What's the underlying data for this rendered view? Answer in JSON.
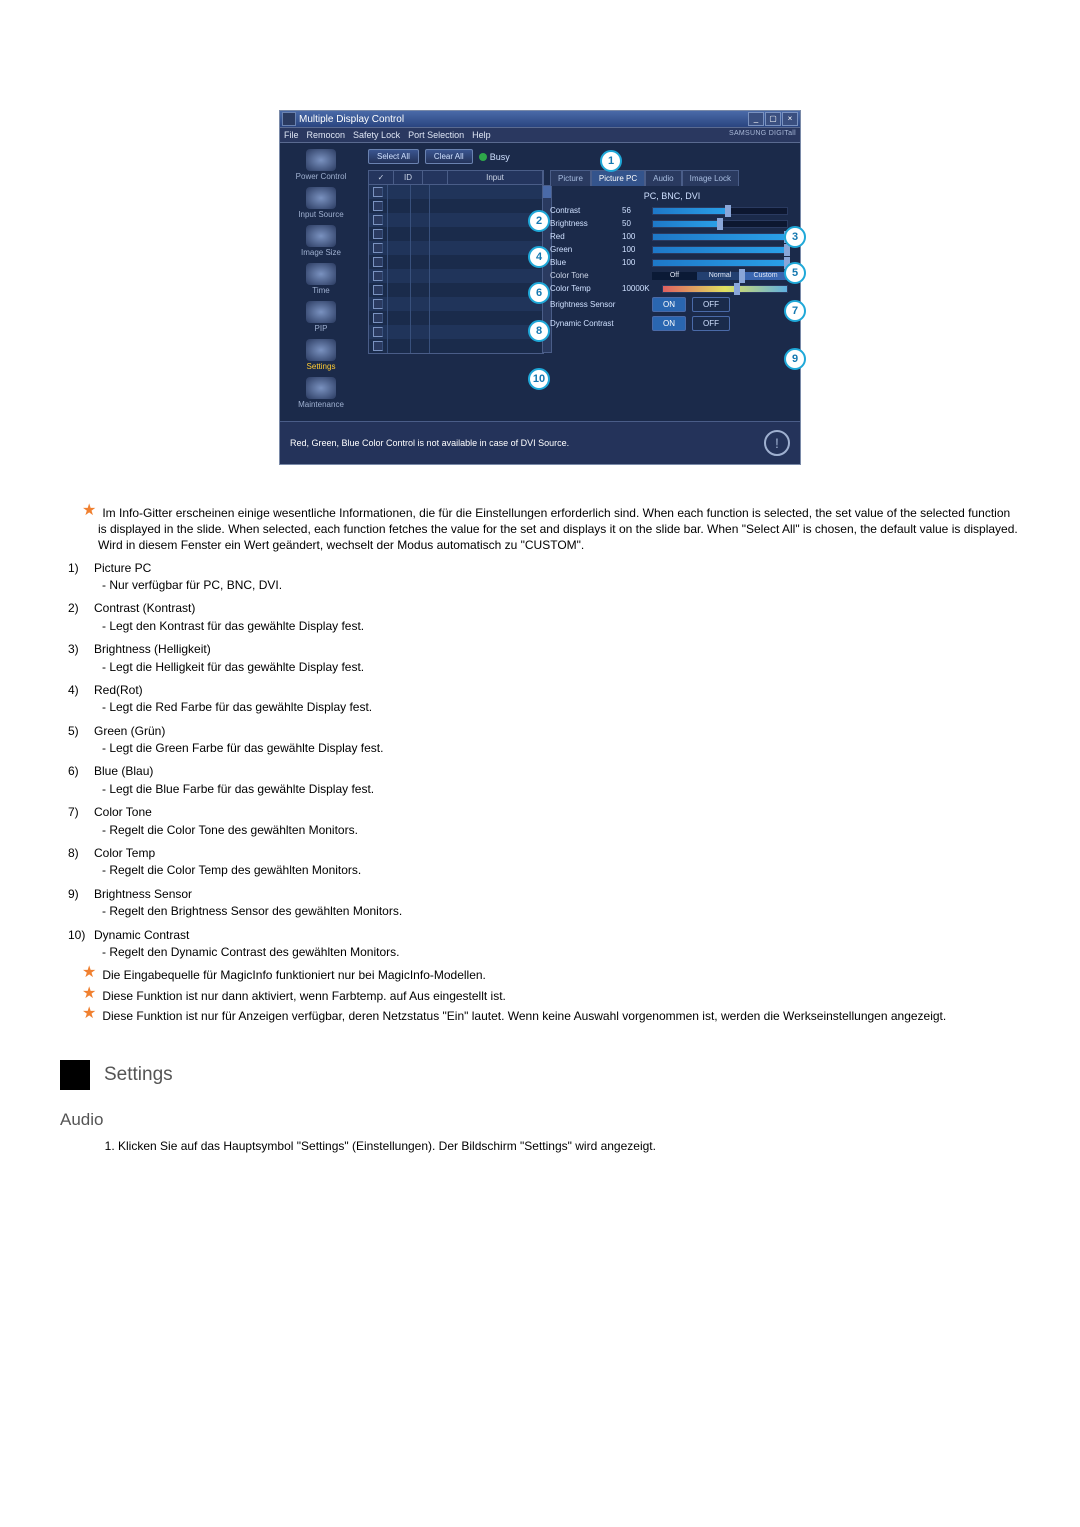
{
  "app": {
    "title": "Multiple Display Control",
    "menu": [
      "File",
      "Remocon",
      "Safety Lock",
      "Port Selection",
      "Help"
    ],
    "brand": "SAMSUNG DIGITall",
    "sidebar": [
      {
        "label": "Power Control"
      },
      {
        "label": "Input Source"
      },
      {
        "label": "Image Size"
      },
      {
        "label": "Time"
      },
      {
        "label": "PIP"
      },
      {
        "label": "Settings",
        "active": true
      },
      {
        "label": "Maintenance"
      }
    ],
    "buttons": {
      "select_all": "Select All",
      "clear_all": "Clear All",
      "busy": "Busy"
    },
    "grid_headers": {
      "chk": "✓",
      "id": "ID",
      "status": "",
      "input": "Input"
    },
    "grid_row_count": 12,
    "tabs": [
      "Picture",
      "Picture PC",
      "Audio",
      "Image Lock"
    ],
    "active_tab": "Picture PC",
    "sub_header": "PC, BNC, DVI",
    "sliders": {
      "contrast": {
        "label": "Contrast",
        "value": 56
      },
      "brightness": {
        "label": "Brightness",
        "value": 50
      },
      "red": {
        "label": "Red",
        "value": 100
      },
      "green": {
        "label": "Green",
        "value": 100
      },
      "blue": {
        "label": "Blue",
        "value": 100
      }
    },
    "color_tone": {
      "label": "Color Tone",
      "options": [
        "Off",
        "Normal",
        "Custom"
      ],
      "selected_pct": 66
    },
    "color_temp": {
      "label": "Color Temp",
      "value": "10000K",
      "pct": 60
    },
    "brightness_sensor": {
      "label": "Brightness Sensor",
      "on": "ON",
      "off": "OFF"
    },
    "dynamic_contrast": {
      "label": "Dynamic Contrast",
      "on": "ON",
      "off": "OFF"
    },
    "footer_msg": "Red, Green, Blue Color Control is not available in case of DVI Source.",
    "callouts": [
      "1",
      "2",
      "3",
      "4",
      "5",
      "6",
      "7",
      "8",
      "9",
      "10"
    ]
  },
  "doc": {
    "intro_note": "Im Info-Gitter erscheinen einige wesentliche Informationen, die für die Einstellungen erforderlich sind. When each function is selected, the set value of the selected function is displayed in the slide. When selected, each function fetches the value for the set and displays it on the slide bar. When \"Select All\" is chosen, the default value is displayed. Wird in diesem Fenster ein Wert geändert, wechselt der Modus automatisch zu \"CUSTOM\".",
    "items": [
      {
        "n": "1)",
        "title": "Picture PC",
        "desc": "- Nur verfügbar für PC, BNC, DVI."
      },
      {
        "n": "2)",
        "title": "Contrast (Kontrast)",
        "desc": "- Legt den Kontrast für das gewählte Display fest."
      },
      {
        "n": "3)",
        "title": "Brightness (Helligkeit)",
        "desc": "- Legt die Helligkeit für das gewählte Display fest."
      },
      {
        "n": "4)",
        "title": "Red(Rot)",
        "desc": "- Legt die Red Farbe für das gewählte Display fest."
      },
      {
        "n": "5)",
        "title": "Green (Grün)",
        "desc": "- Legt die Green Farbe für das gewählte Display fest."
      },
      {
        "n": "6)",
        "title": "Blue (Blau)",
        "desc": "- Legt die Blue Farbe für das gewählte Display fest."
      },
      {
        "n": "7)",
        "title": "Color Tone",
        "desc": "- Regelt die Color Tone des gewählten Monitors."
      },
      {
        "n": "8)",
        "title": "Color Temp",
        "desc": "- Regelt die Color Temp des gewählten Monitors."
      },
      {
        "n": "9)",
        "title": "Brightness Sensor",
        "desc": "- Regelt den Brightness Sensor des gewählten Monitors."
      },
      {
        "n": "10)",
        "title": "Dynamic Contrast",
        "desc": "- Regelt den Dynamic Contrast des gewählten Monitors."
      }
    ],
    "star_notes": [
      "Die Eingabequelle für MagicInfo funktioniert nur bei MagicInfo-Modellen.",
      "Diese Funktion ist nur dann aktiviert, wenn Farbtemp. auf Aus eingestellt ist.",
      "Diese Funktion ist nur für Anzeigen verfügbar, deren Netzstatus \"Ein\" lautet. Wenn keine Auswahl vorgenommen ist, werden die Werkseinstellungen angezeigt."
    ],
    "section_title": "Settings",
    "subsection_title": "Audio",
    "audio_step": "Klicken Sie auf das Hauptsymbol \"Settings\" (Einstellungen). Der Bildschirm \"Settings\" wird angezeigt."
  }
}
